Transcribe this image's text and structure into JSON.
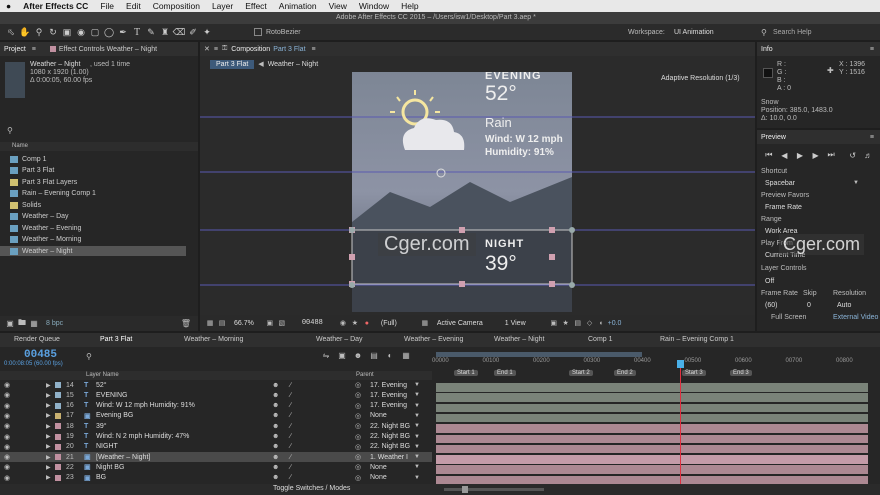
{
  "menu": {
    "apple": "",
    "items": [
      "After Effects CC",
      "File",
      "Edit",
      "Composition",
      "Layer",
      "Effect",
      "Animation",
      "View",
      "Window",
      "Help"
    ],
    "title": "Adobe After Effects CC 2015 – /Users/isw1/Desktop/Part 3.aep *"
  },
  "toolbar": {
    "roto": "RotoBezier",
    "workspace_label": "Workspace:",
    "workspace": "UI Animation",
    "search": "Search Help"
  },
  "project": {
    "tab": "Project",
    "effect_tab": "Effect Controls Weather – Night",
    "item_name": "Weather – Night",
    "used": ", used 1 time",
    "dims": "1080 x 1920 (1.00)",
    "dur": "Δ 0:00:05, 60.00 fps",
    "col_name": "Name",
    "items": [
      {
        "name": "Comp 1",
        "type": "comp",
        "color": "#6aa0c0"
      },
      {
        "name": "Part 3 Flat",
        "type": "comp",
        "color": "#6aa0c0"
      },
      {
        "name": "Part 3 Flat Layers",
        "type": "folder",
        "color": "#d0c070"
      },
      {
        "name": "Rain – Evening Comp 1",
        "type": "comp",
        "color": "#6aa0c0"
      },
      {
        "name": "Solids",
        "type": "folder",
        "color": "#d0c070"
      },
      {
        "name": "Weather – Day",
        "type": "comp",
        "color": "#6aa0c0"
      },
      {
        "name": "Weather – Evening",
        "type": "comp",
        "color": "#6aa0c0"
      },
      {
        "name": "Weather – Morning",
        "type": "comp",
        "color": "#6aa0c0"
      },
      {
        "name": "Weather – Night",
        "type": "comp",
        "color": "#6aa0c0"
      }
    ],
    "bpc": "8 bpc"
  },
  "comp": {
    "tab_label": "Composition",
    "tab_name": "Part 3 Flat",
    "breadcrumb1": "Part 3 Flat",
    "breadcrumb2": "Weather – Night",
    "adaptive": "Adaptive Resolution (1/3)",
    "evening": "EVENING",
    "temp1": "52°",
    "rain": "Rain",
    "wind": "Wind: W 12 mph",
    "humidity": "Humidity: 91%",
    "night": "NIGHT",
    "temp2": "39°",
    "watermark": "Cger.com",
    "zoom": "66.7%",
    "timecode": "00488",
    "quality": "(Full)",
    "camera": "Active Camera",
    "view": "1 View",
    "exposure": "+0.0"
  },
  "info": {
    "tab": "Info",
    "r": "R :",
    "g": "G :",
    "b": "B :",
    "a": "A : 0",
    "x": "X : 1396",
    "y": "Y : 1516",
    "name": "Snow",
    "pos": "Position: 385.0, 1483.0",
    "delta": "Δ: 10.0, 0.0"
  },
  "preview": {
    "tab": "Preview",
    "shortcut_label": "Shortcut",
    "shortcut": "Spacebar",
    "favors_label": "Preview Favors",
    "favors": "Frame Rate",
    "range_label": "Range",
    "range": "Work Area",
    "play_label": "Play From",
    "play": "Current Time",
    "layer_label": "Layer Controls",
    "layer": "Off",
    "fr_label": "Frame Rate",
    "skip_label": "Skip",
    "res_label": "Resolution",
    "fr": "(60)",
    "skip": "0",
    "res": "Auto",
    "full": "Full Screen",
    "external": "External Video"
  },
  "timeline": {
    "tabs": [
      "Render Queue",
      "Part 3 Flat",
      "Weather – Morning",
      "Weather – Day",
      "Weather – Evening",
      "Weather – Night",
      "Comp 1",
      "Rain – Evening Comp 1"
    ],
    "time": "00485",
    "time_sub": "0:00:08:05 (60.00 fps)",
    "col_layer": "Layer Name",
    "col_parent": "Parent",
    "ruler": [
      "00000",
      "00100",
      "00200",
      "00300",
      "00400",
      "00500",
      "00600",
      "00700",
      "00800"
    ],
    "markers": [
      "Start 1",
      "End 1",
      "Start 2",
      "End 2",
      "Start 3",
      "End 3"
    ],
    "toggle": "Toggle Switches / Modes",
    "layers": [
      {
        "num": "14",
        "name": "52°",
        "type": "T",
        "color": "#8fb0c8",
        "parent": "17. Evening"
      },
      {
        "num": "15",
        "name": "EVENING",
        "type": "T",
        "color": "#8fb0c8",
        "parent": "17. Evening"
      },
      {
        "num": "16",
        "name": "Wind: W 12 mph Humidity: 91%",
        "type": "T",
        "color": "#8fb0c8",
        "parent": "17. Evening"
      },
      {
        "num": "17",
        "name": "Evening BG",
        "type": "S",
        "color": "#c8b070",
        "parent": "None"
      },
      {
        "num": "18",
        "name": "39°",
        "type": "T",
        "color": "#c090a0",
        "parent": "22. Night BG"
      },
      {
        "num": "19",
        "name": "Wind: N 2 mph Humidity: 47%",
        "type": "T",
        "color": "#c090a0",
        "parent": "22. Night BG"
      },
      {
        "num": "20",
        "name": "NIGHT",
        "type": "T",
        "color": "#c090a0",
        "parent": "22. Night BG"
      },
      {
        "num": "21",
        "name": "[Weather – Night]",
        "type": "C",
        "color": "#c090a0",
        "parent": "1. Weather I"
      },
      {
        "num": "22",
        "name": "Night BG",
        "type": "S",
        "color": "#c090a0",
        "parent": "None"
      },
      {
        "num": "23",
        "name": "BG",
        "type": "S",
        "color": "#c090a0",
        "parent": "None"
      }
    ]
  }
}
